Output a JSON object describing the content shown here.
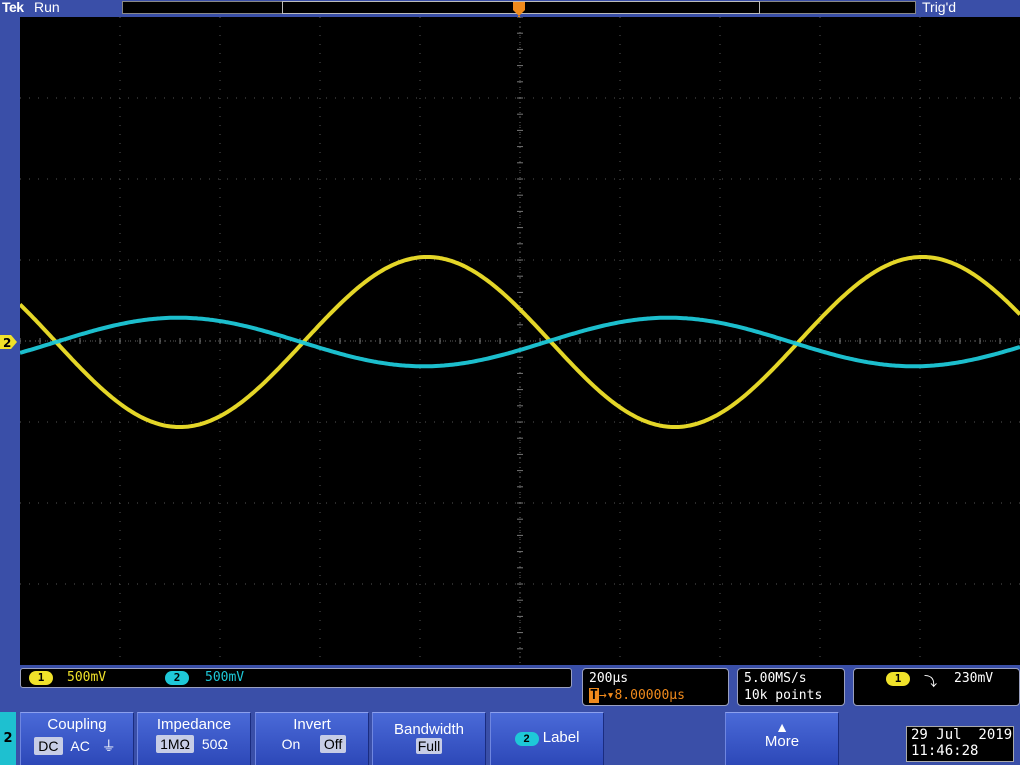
{
  "header": {
    "brand": "Tek",
    "acquisition_state": "Run",
    "trigger_state": "Trig'd",
    "trigger_position_marker": "T"
  },
  "colors": {
    "ch1": "#f0e22a",
    "ch2": "#1ec8d8",
    "trigger": "#f08a1c",
    "background": "#000000",
    "frame": "#3a4fa8"
  },
  "chart_data": {
    "type": "line",
    "grid": {
      "x_divisions": 10,
      "y_divisions": 8,
      "visible": true
    },
    "x_unit_per_div_us": 200,
    "series": [
      {
        "name": "1",
        "amplitude_div": 1.05,
        "period_div": 4.95,
        "phase_start": "falling",
        "dc_div": 0
      },
      {
        "name": "2",
        "amplitude_div": 0.3,
        "period_div": 4.9,
        "phase_start": "rising",
        "dc_div": 0
      }
    ]
  },
  "channels": {
    "ch1": {
      "number": "1",
      "scale": "500mV"
    },
    "ch2": {
      "number": "2",
      "scale": "500mV",
      "ground_marker": "2"
    }
  },
  "timebase": {
    "scale": "200µs",
    "delay_prefix": "T",
    "delay": "→▾8.00000µs"
  },
  "acquisition": {
    "sample_rate": "5.00MS/s",
    "record_length": "10k points"
  },
  "trigger": {
    "source": "1",
    "slope_symbol": "⤵",
    "level": "230mV"
  },
  "menu": {
    "active_channel": "2",
    "coupling": {
      "title": "Coupling",
      "options": [
        "DC",
        "AC",
        "⏚"
      ],
      "selected": 0
    },
    "impedance": {
      "title": "Impedance",
      "options": [
        "1MΩ",
        "50Ω"
      ],
      "selected": 0
    },
    "invert": {
      "title": "Invert",
      "options": [
        "On",
        "Off"
      ],
      "selected": 1
    },
    "bandwidth": {
      "title": "Bandwidth",
      "value": "Full"
    },
    "label": {
      "channel": "2",
      "title": "Label"
    },
    "more": {
      "title": "More",
      "arrow": "▲"
    }
  },
  "datetime": {
    "date": "29 Jul  2019",
    "time": "11:46:28"
  }
}
